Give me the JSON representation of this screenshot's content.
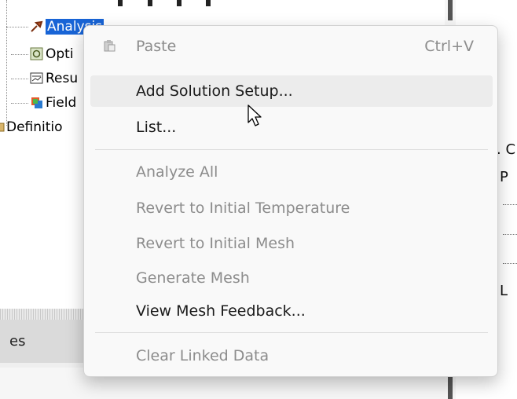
{
  "tree": {
    "items": [
      {
        "label": "Analysis",
        "selected": true,
        "icon": "analysis-icon"
      },
      {
        "label": "Opti",
        "icon": "optimetrics-icon"
      },
      {
        "label": "Resu",
        "icon": "results-icon"
      },
      {
        "label": "Field",
        "icon": "field-overlays-icon"
      },
      {
        "label": "Definitio",
        "icon": "definitions-icon"
      }
    ]
  },
  "right_panel": {
    "items": [
      ". C",
      "P",
      "L"
    ]
  },
  "bottom": {
    "tab_label": "es"
  },
  "context_menu": {
    "items": [
      {
        "label": "Paste",
        "shortcut": "Ctrl+V",
        "disabled": true,
        "icon": "paste-icon"
      },
      {
        "label": "Add Solution Setup...",
        "disabled": false,
        "hovered": true
      },
      {
        "label": "List...",
        "disabled": false
      },
      {
        "label": "Analyze All",
        "disabled": true
      },
      {
        "label": "Revert to Initial Temperature",
        "disabled": true
      },
      {
        "label": "Revert to Initial Mesh",
        "disabled": true
      },
      {
        "label": "Generate Mesh",
        "disabled": true
      },
      {
        "label": "View Mesh Feedback...",
        "disabled": false
      },
      {
        "label": "Clear Linked Data",
        "disabled": true
      }
    ]
  },
  "colors": {
    "selection": "#1864d6",
    "menu_background": "#f9f9f9",
    "hover": "#ececec",
    "disabled_text": "#8c8c8c"
  }
}
